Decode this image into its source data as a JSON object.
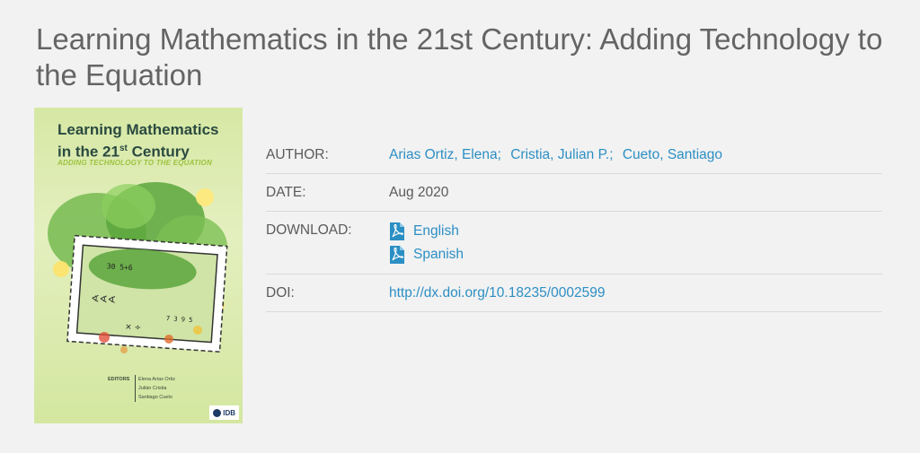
{
  "page": {
    "title": "Learning Mathematics in the 21st Century: Adding Technology to the Equation"
  },
  "cover": {
    "title_line1": "Learning Mathematics",
    "title_line2_pre": "in the 21",
    "title_line2_sup": "st",
    "title_line2_post": " Century",
    "subtitle": "ADDING TECHNOLOGY TO THE EQUATION",
    "editors_label": "EDITORS",
    "editors": [
      "Elena Arias Ortiz",
      "Julián Cristia",
      "Santiago Cueto"
    ],
    "publisher": "IDB"
  },
  "details": {
    "author_label": "AUTHOR:",
    "authors": [
      "Arias Ortiz, Elena",
      "Cristia, Julian P.",
      "Cueto, Santiago"
    ],
    "date_label": "DATE:",
    "date_value": "Aug 2020",
    "download_label": "DOWNLOAD:",
    "downloads": [
      {
        "label": "English",
        "icon": "pdf-icon"
      },
      {
        "label": "Spanish",
        "icon": "pdf-icon"
      }
    ],
    "doi_label": "DOI:",
    "doi_value": "http://dx.doi.org/10.18235/0002599"
  },
  "colors": {
    "link": "#2c8fc4",
    "title": "#646464",
    "background": "#f2f2f2",
    "pdf": "#2c8fc4"
  }
}
